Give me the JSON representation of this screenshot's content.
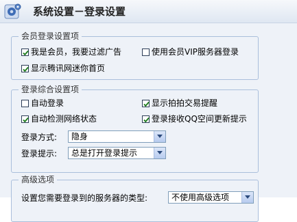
{
  "window": {
    "title": "系统设置－登录设置"
  },
  "member_group": {
    "legend": "会员登录设置项",
    "options": [
      {
        "label": "我是会员，我要过滤广告",
        "checked": true
      },
      {
        "label": "使用会员VIP服务器登录",
        "checked": false
      },
      {
        "label": "显示腾讯网迷你首页",
        "checked": true
      }
    ]
  },
  "general_group": {
    "legend": "登录综合设置项",
    "options": [
      {
        "label": "自动登录",
        "checked": false
      },
      {
        "label": "显示拍拍交易提醒",
        "checked": true
      },
      {
        "label": "自动检测网络状态",
        "checked": true
      },
      {
        "label": "登录接收QQ空间更新提示",
        "checked": true
      }
    ],
    "login_mode_label": "登录方式:",
    "login_mode_value": "隐身",
    "login_prompt_label": "登录提示:",
    "login_prompt_value": "总是打开登录提示"
  },
  "advanced_group": {
    "legend": "高级选项",
    "server_label": "设置您需要登录到的服务器的类型:",
    "server_value": "不使用高级选项"
  },
  "colors": {
    "accent": "#2b5797",
    "border": "#a9bedb",
    "panel": "#eef2f8"
  },
  "icons": {
    "title": "gear-icon",
    "check": "check-icon",
    "dropdown": "chevron-down-icon"
  }
}
